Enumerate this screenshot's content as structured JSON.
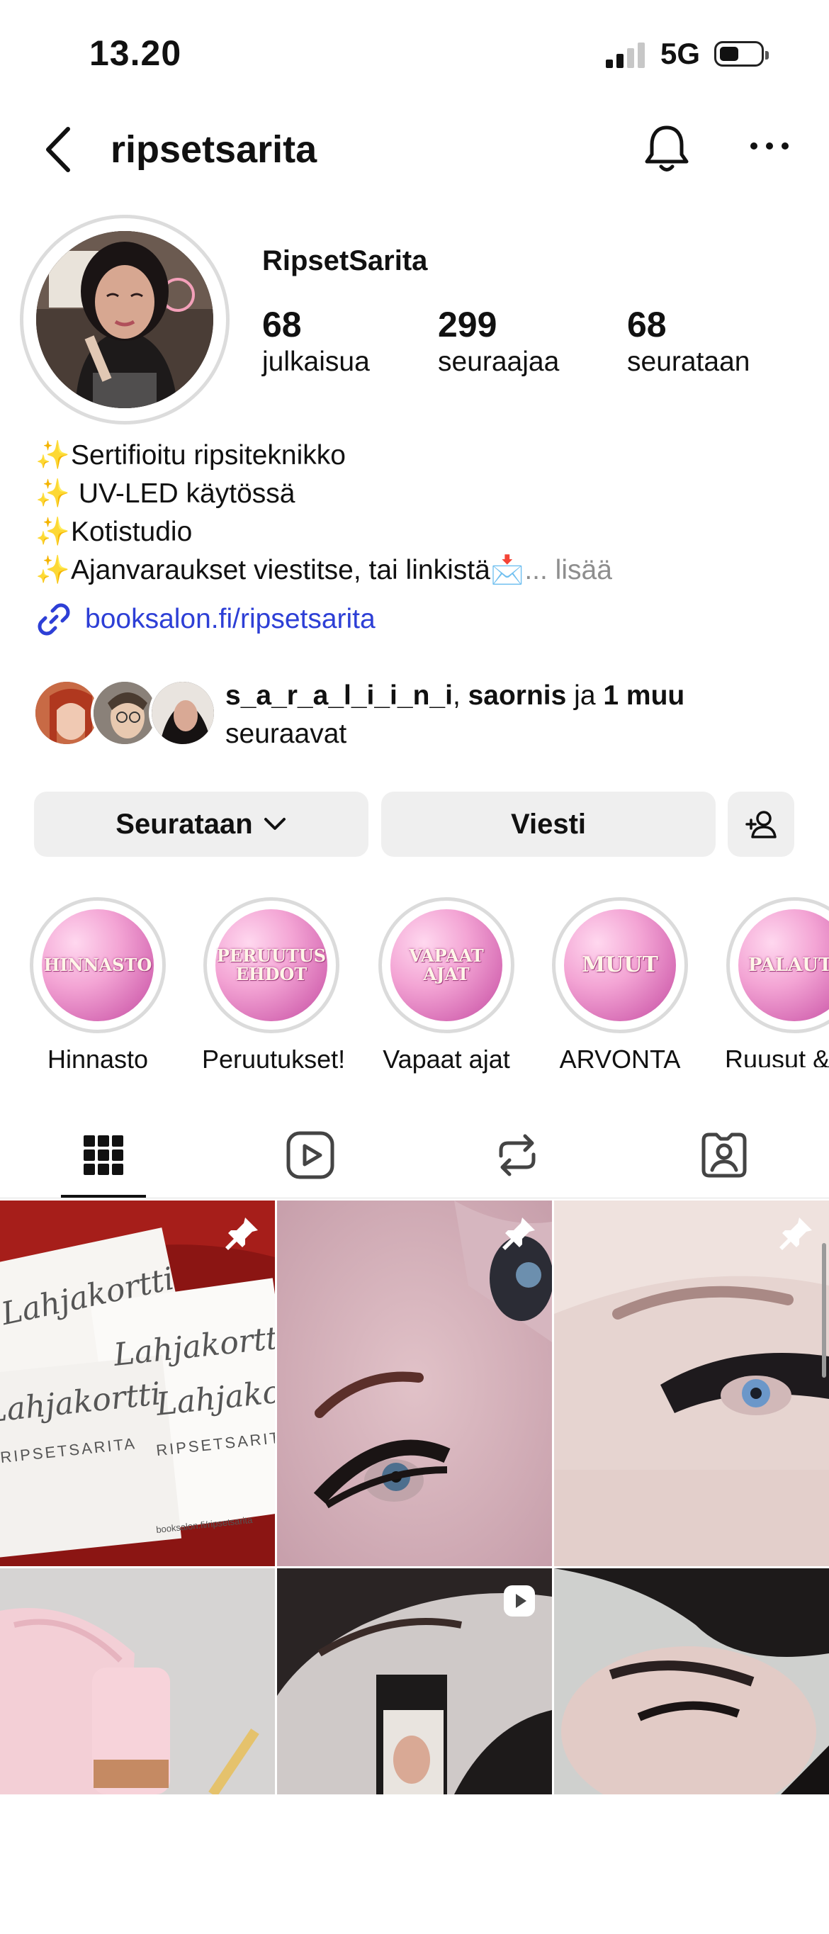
{
  "status_bar": {
    "time": "13.20",
    "network": "5G"
  },
  "header": {
    "username": "ripsetsarita"
  },
  "profile": {
    "display_name": "RipsetSarita",
    "stats": [
      {
        "value": "68",
        "label": "julkaisua"
      },
      {
        "value": "299",
        "label": "seuraajaa"
      },
      {
        "value": "68",
        "label": "seurataan"
      }
    ],
    "bio_lines": [
      "Sertifioitu ripsiteknikko",
      " UV-LED käytössä",
      "Kotistudio",
      "Ajanvaraukset viestitse, tai linkistä"
    ],
    "bio_more": "... lisää",
    "link": "booksalon.fi/ripsetsarita",
    "followed_by": {
      "name1": "s_a_r_a_l_i_i_n_i",
      "separator": ", ",
      "name2": "saornis",
      "conj": " ja ",
      "others": "1 muu",
      "suffix": "seuraavat"
    }
  },
  "buttons": {
    "following": "Seurataan",
    "message": "Viesti"
  },
  "highlights": [
    {
      "cover": "HINNASTO",
      "caption": "Hinnasto"
    },
    {
      "cover": "PERUUTUS EHDOT",
      "caption": "Peruutukset!"
    },
    {
      "cover": "VAPAAT AJAT",
      "caption": "Vapaat ajat"
    },
    {
      "cover": "MUUT",
      "caption": "ARVONTA"
    },
    {
      "cover": "PALAUT",
      "caption": "Ruusut &"
    }
  ],
  "tabs": [
    "grid-icon",
    "reels-icon",
    "reposts-icon",
    "tagged-icon"
  ],
  "posts": {
    "gift_card_title": "Lahjakortti",
    "gift_card_brand": "RIPSETSARITA",
    "gift_card_url": "booksalon.fi/ripsetsarita"
  },
  "colors": {
    "link": "#2d3fd6",
    "button_bg": "#efefef",
    "highlight_pink": "#e08ac4"
  }
}
